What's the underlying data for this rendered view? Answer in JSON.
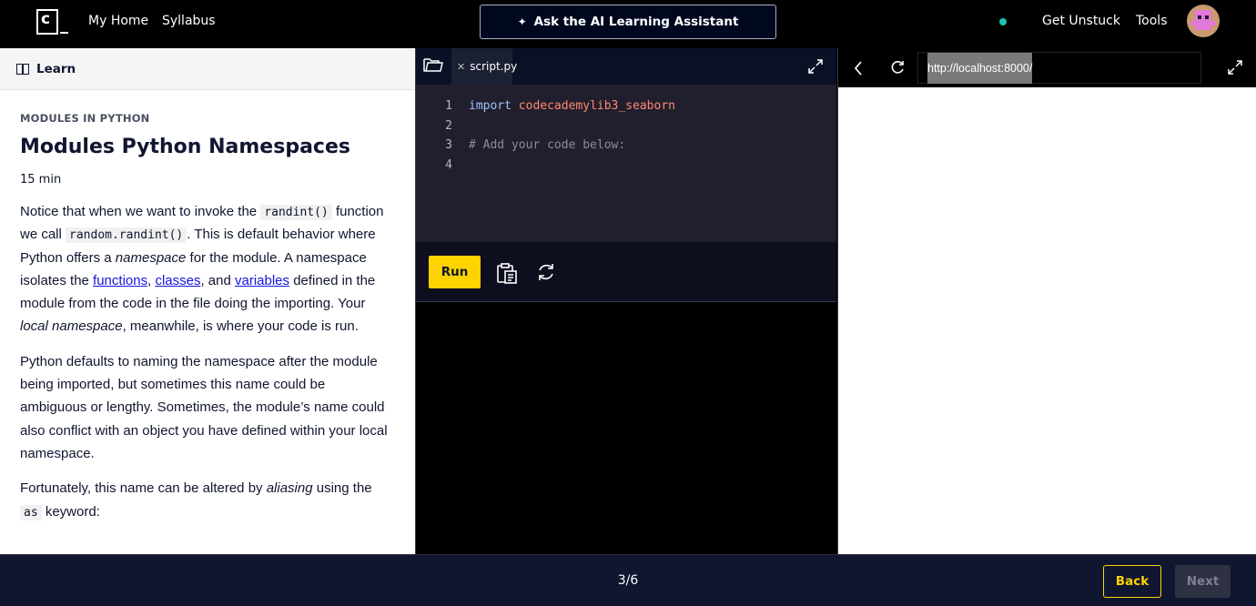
{
  "topbar": {
    "logo_letter": "c",
    "nav": [
      "My Home",
      "Syllabus"
    ],
    "ai_button": "Ask the AI Learning Assistant",
    "get_unstuck": "Get Unstuck",
    "tools": "Tools",
    "status_color": "#1fc4b3"
  },
  "lesson": {
    "header": "Learn",
    "kicker": "MODULES IN PYTHON",
    "title": "Modules Python Namespaces",
    "duration": "15 min",
    "p1": {
      "t1": "Notice that when we want to invoke the ",
      "code1": "randint()",
      "t2": " function we call ",
      "code2": "random.randint()",
      "t3": ". This is default behavior where Python offers a ",
      "em1": "namespace",
      "t4": " for the module. A namespace isolates the ",
      "link1": "functions",
      "t5": ", ",
      "link2": "classes",
      "t6": ", and ",
      "link3": "variables",
      "t7": " defined in the module from the code in the file doing the importing. Your ",
      "em2": "local namespace",
      "t8": ", meanwhile, is where your code is run."
    },
    "p2": "Python defaults to naming the namespace after the module being imported, but sometimes this name could be ambiguous or lengthy. Sometimes, the module’s name could also conflict with an object you have defined within your local namespace.",
    "p3": {
      "t1": "Fortunately, this name can be altered by ",
      "em": "aliasing",
      "t2": " using the ",
      "code": "as",
      "t3": " keyword:"
    }
  },
  "editor": {
    "tab_name": "script.py",
    "lines": [
      {
        "num": "1",
        "keyword": "import",
        "module": "codecademylib3_seaborn"
      },
      {
        "num": "2",
        "text": ""
      },
      {
        "num": "3",
        "comment": "# Add your code below:"
      },
      {
        "num": "4",
        "text": ""
      }
    ],
    "run_label": "Run"
  },
  "browser": {
    "url": "http://localhost:8000/"
  },
  "footer": {
    "progress": "3/6",
    "back": "Back",
    "next": "Next"
  },
  "colors": {
    "accent_yellow": "#ffd300",
    "navy": "#10162f",
    "link_blue": "#1515e0"
  }
}
